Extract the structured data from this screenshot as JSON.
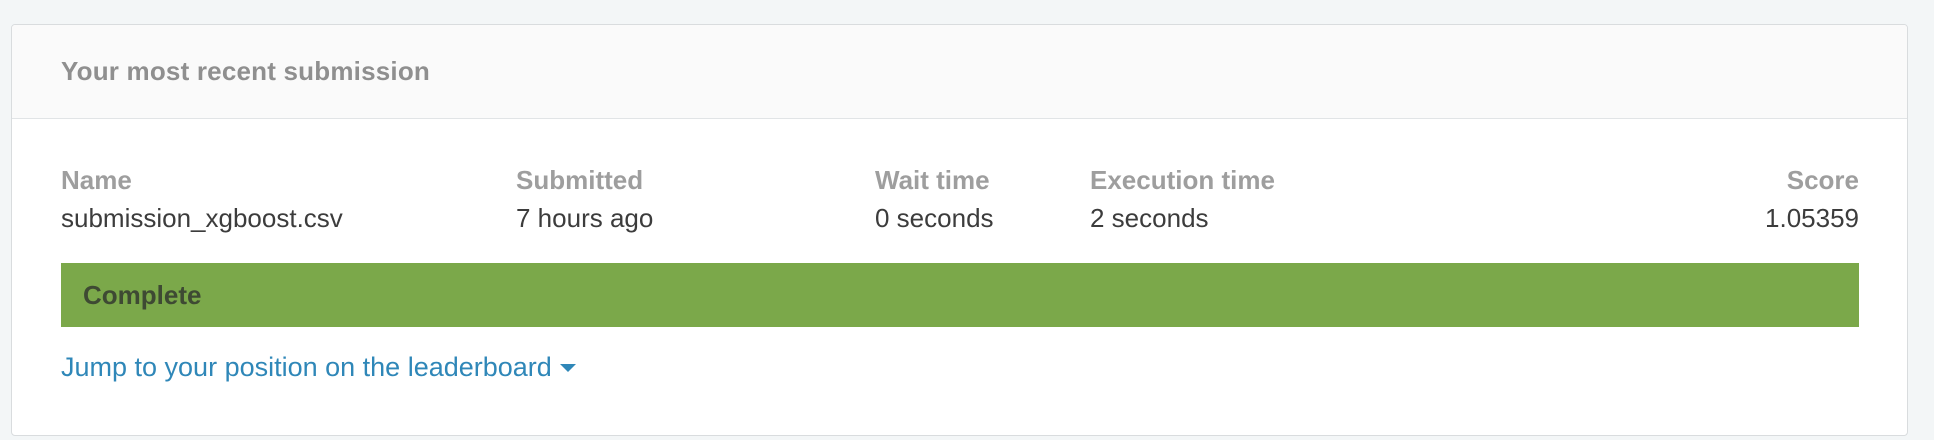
{
  "card": {
    "title": "Your most recent submission"
  },
  "submission": {
    "columns": [
      {
        "label": "Name",
        "value": "submission_xgboost.csv"
      },
      {
        "label": "Submitted",
        "value": "7 hours ago"
      },
      {
        "label": "Wait time",
        "value": "0 seconds"
      },
      {
        "label": "Execution time",
        "value": "2 seconds"
      },
      {
        "label": "Score",
        "value": "1.05359"
      }
    ],
    "status": "Complete",
    "status_color": "#7ba84a"
  },
  "leaderboard_link": {
    "label": "Jump to your position on the leaderboard",
    "icon": "caret-down-icon",
    "color": "#2f87b8"
  }
}
